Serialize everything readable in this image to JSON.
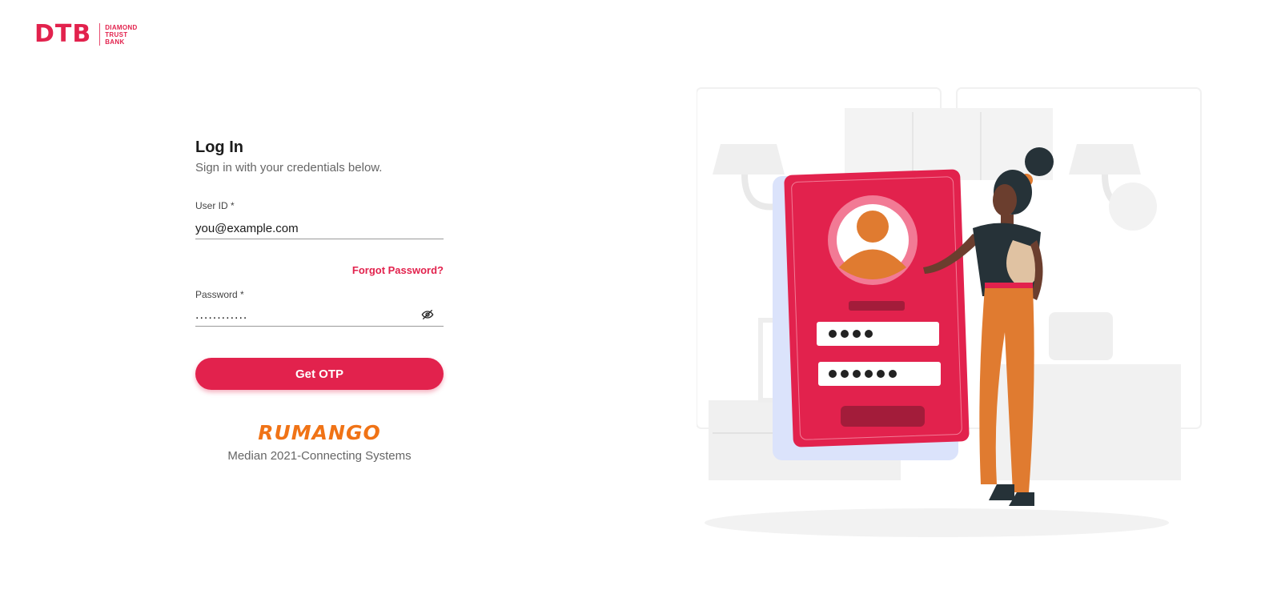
{
  "logo": {
    "mark": "DTB",
    "line1": "DIAMOND",
    "line2": "TRUST",
    "line3": "BANK"
  },
  "login": {
    "title": "Log In",
    "subtitle": "Sign in with your credentials below.",
    "user_id_label": "User ID *",
    "user_id_value": "you@example.com",
    "forgot_password": "Forgot Password?",
    "password_label": "Password *",
    "password_value": "............",
    "submit_label": "Get OTP"
  },
  "footer": {
    "brand": "RUMANGO",
    "tagline": "Median 2021-Connecting Systems"
  },
  "colors": {
    "brand": "#e2224d",
    "accent": "#f07316"
  },
  "icons": {
    "password_toggle": "eye-off-icon"
  }
}
